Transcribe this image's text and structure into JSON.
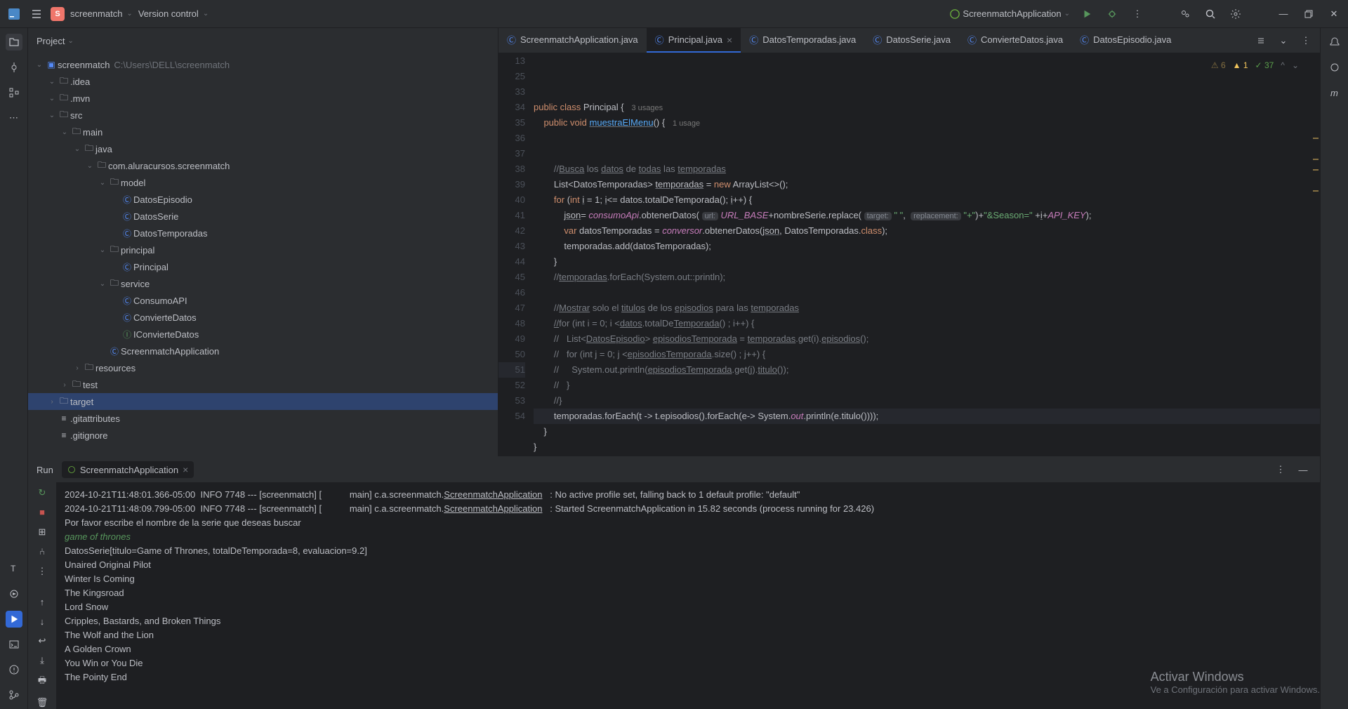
{
  "titlebar": {
    "project_badge": "S",
    "project_name": "screenmatch",
    "vcs_label": "Version control",
    "run_config": "ScreenmatchApplication"
  },
  "left_rail": {
    "items": [
      "folder",
      "structure",
      "bookmarks",
      "more"
    ]
  },
  "project_panel": {
    "title": "Project",
    "root": {
      "name": "screenmatch",
      "path": "C:\\Users\\DELL\\screenmatch"
    },
    "tree": [
      {
        "d": 1,
        "exp": true,
        "icon": "folder",
        "label": ".idea"
      },
      {
        "d": 1,
        "exp": true,
        "icon": "folder",
        "label": ".mvn"
      },
      {
        "d": 1,
        "exp": true,
        "icon": "folder",
        "label": "src"
      },
      {
        "d": 2,
        "exp": true,
        "icon": "folder",
        "label": "main"
      },
      {
        "d": 3,
        "exp": true,
        "icon": "folder",
        "label": "java"
      },
      {
        "d": 4,
        "exp": true,
        "icon": "folder",
        "label": "com.aluracursos.screenmatch"
      },
      {
        "d": 5,
        "exp": true,
        "icon": "folder",
        "label": "model"
      },
      {
        "d": 6,
        "exp": null,
        "icon": "class",
        "label": "DatosEpisodio"
      },
      {
        "d": 6,
        "exp": null,
        "icon": "class",
        "label": "DatosSerie"
      },
      {
        "d": 6,
        "exp": null,
        "icon": "class",
        "label": "DatosTemporadas"
      },
      {
        "d": 5,
        "exp": true,
        "icon": "folder",
        "label": "principal"
      },
      {
        "d": 6,
        "exp": null,
        "icon": "class",
        "label": "Principal"
      },
      {
        "d": 5,
        "exp": true,
        "icon": "folder",
        "label": "service"
      },
      {
        "d": 6,
        "exp": null,
        "icon": "class",
        "label": "ConsumoAPI"
      },
      {
        "d": 6,
        "exp": null,
        "icon": "class",
        "label": "ConvierteDatos"
      },
      {
        "d": 6,
        "exp": null,
        "icon": "interface",
        "label": "IConvierteDatos"
      },
      {
        "d": 5,
        "exp": null,
        "icon": "class",
        "label": "ScreenmatchApplication"
      },
      {
        "d": 3,
        "exp": false,
        "icon": "folder",
        "label": "resources"
      },
      {
        "d": 2,
        "exp": false,
        "icon": "folder",
        "label": "test"
      },
      {
        "d": 1,
        "exp": false,
        "icon": "folder",
        "label": "target",
        "selected": true
      },
      {
        "d": 1,
        "exp": null,
        "icon": "file",
        "label": ".gitattributes"
      },
      {
        "d": 1,
        "exp": null,
        "icon": "file",
        "label": ".gitignore"
      }
    ]
  },
  "editor": {
    "tabs": [
      {
        "label": "ScreenmatchApplication.java",
        "icon": "class"
      },
      {
        "label": "Principal.java",
        "icon": "class",
        "active": true,
        "closeable": true
      },
      {
        "label": "DatosTemporadas.java",
        "icon": "class"
      },
      {
        "label": "DatosSerie.java",
        "icon": "class"
      },
      {
        "label": "ConvierteDatos.java",
        "icon": "class"
      },
      {
        "label": "DatosEpisodio.java",
        "icon": "class"
      }
    ],
    "inspections": {
      "weak_warn": "6",
      "warn": "1",
      "ok": "37"
    },
    "first_line_no": 13,
    "lines": [
      {
        "n": 13,
        "html": "<span class='kw'>public class</span> Principal {   <span class='hint'>3 usages</span>"
      },
      {
        "n": 25,
        "html": "    <span class='kw'>public void</span> <span class='fn id-u'>muestraElMenu</span>() {   <span class='hint'>1 usage</span>"
      },
      {
        "n": 33,
        "html": ""
      },
      {
        "n": 34,
        "html": ""
      },
      {
        "n": 35,
        "html": "        <span class='com'>//</span><span class='com-u'>Busca</span><span class='com'> los </span><span class='com-u'>datos</span><span class='com'> de </span><span class='com-u'>todas</span><span class='com'> las </span><span class='com-u'>temporadas</span>"
      },
      {
        "n": 36,
        "html": "        List&lt;DatosTemporadas&gt; <span class='id-u'>temporadas</span> = <span class='kw'>new</span> ArrayList&lt;&gt;();"
      },
      {
        "n": 37,
        "html": "        <span class='kw'>for</span> (<span class='kw'>int</span> <span class='id-u'>i</span> = 1; <span class='id-u'>i</span>&lt;= datos.totalDeTemporada(); <span class='id-u'>i</span>++) {"
      },
      {
        "n": 38,
        "html": "            <span class='id-u'>json</span>= <span class='fld'>consumoApi</span>.obtenerDatos( <span class='param-hint'>url:</span> <span class='fld'>URL_BASE</span>+nombreSerie.replace( <span class='param-hint'>target:</span> <span class='str'>\" \"</span>,  <span class='param-hint'>replacement:</span> <span class='str'>\"+\"</span>)+<span class='str'>\"&amp;Season=\"</span> +<span class='id-u'>i</span>+<span class='fld'>API_KEY</span>);"
      },
      {
        "n": 39,
        "html": "            <span class='kw'>var</span> datosTemporadas = <span class='fld'>conversor</span>.obtenerDatos(<span class='id-u'>json</span>, DatosTemporadas.<span class='kw'>class</span>);"
      },
      {
        "n": 40,
        "html": "            temporadas.add(datosTemporadas);"
      },
      {
        "n": 41,
        "html": "        }"
      },
      {
        "n": 42,
        "html": "        <span class='com'>//</span><span class='com-u'>temporadas</span><span class='com'>.forEach(System.out::println);</span>"
      },
      {
        "n": 43,
        "html": ""
      },
      {
        "n": 44,
        "html": "        <span class='com'>//</span><span class='com-u'>Mostrar</span><span class='com'> solo el </span><span class='com-u'>titulos</span><span class='com'> de los </span><span class='com-u'>episodios</span><span class='com'> para las </span><span class='com-u'>temporadas</span>"
      },
      {
        "n": 45,
        "html": "        <span class='com-u'>//</span><span class='com'>for (int i = 0; i &lt;</span><span class='com-u'>datos</span><span class='com'>.totalDe</span><span class='com-u'>Temporada</span><span class='com'>() ; i++) {</span>"
      },
      {
        "n": 46,
        "html": "        <span class='com'>//   List&lt;</span><span class='com-u'>DatosEpisodio</span><span class='com'>&gt; </span><span class='com-u'>episodiosTemporada</span><span class='com'> = </span><span class='com-u'>temporadas</span><span class='com'>.get(i).</span><span class='com-u'>episodios</span><span class='com'>();</span>"
      },
      {
        "n": 47,
        "html": "        <span class='com'>//   for (int j = 0; j &lt;</span><span class='com-u'>episodiosTemporada</span><span class='com'>.size() ; j++) {</span>"
      },
      {
        "n": 48,
        "html": "        <span class='com'>//     System.out.println(</span><span class='com-u'>episodiosTemporada</span><span class='com'>.get(j).</span><span class='com-u'>titulo</span><span class='com'>());</span>"
      },
      {
        "n": 49,
        "html": "        <span class='com'>//   }</span>"
      },
      {
        "n": 50,
        "html": "        <span class='com'>//}</span>"
      },
      {
        "n": 51,
        "html": "        temporadas.forEach(t -> t.episodios().forEach(e-> System.<span class='fld'>out</span>.println(e.titulo())));",
        "current": true
      },
      {
        "n": 52,
        "html": "    }"
      },
      {
        "n": 53,
        "html": "}"
      },
      {
        "n": 54,
        "html": ""
      }
    ]
  },
  "run": {
    "title": "Run",
    "tab_label": "ScreenmatchApplication",
    "console_lines": [
      {
        "t": "2024-10-21T11:48:01.366-05:00  INFO 7748 --- [screenmatch] [           main] c.a.screenmatch.",
        "link": "ScreenmatchApplication",
        "rest": "   : No active profile set, falling back to 1 default profile: \"default\""
      },
      {
        "t": "2024-10-21T11:48:09.799-05:00  INFO 7748 --- [screenmatch] [           main] c.a.screenmatch.",
        "link": "ScreenmatchApplication",
        "rest": "   : Started ScreenmatchApplication in 15.82 seconds (process running for 23.426)"
      },
      {
        "t": "Por favor escribe el nombre de la serie que deseas buscar"
      },
      {
        "t": "game of thrones",
        "cls": "inp"
      },
      {
        "t": "DatosSerie[titulo=Game of Thrones, totalDeTemporada=8, evaluacion=9.2]"
      },
      {
        "t": "Unaired Original Pilot"
      },
      {
        "t": "Winter Is Coming"
      },
      {
        "t": "The Kingsroad"
      },
      {
        "t": "Lord Snow"
      },
      {
        "t": "Cripples, Bastards, and Broken Things"
      },
      {
        "t": "The Wolf and the Lion"
      },
      {
        "t": "A Golden Crown"
      },
      {
        "t": "You Win or You Die"
      },
      {
        "t": "The Pointy End"
      }
    ]
  },
  "watermark": {
    "line1": "Activar Windows",
    "line2": "Ve a Configuración para activar Windows."
  }
}
